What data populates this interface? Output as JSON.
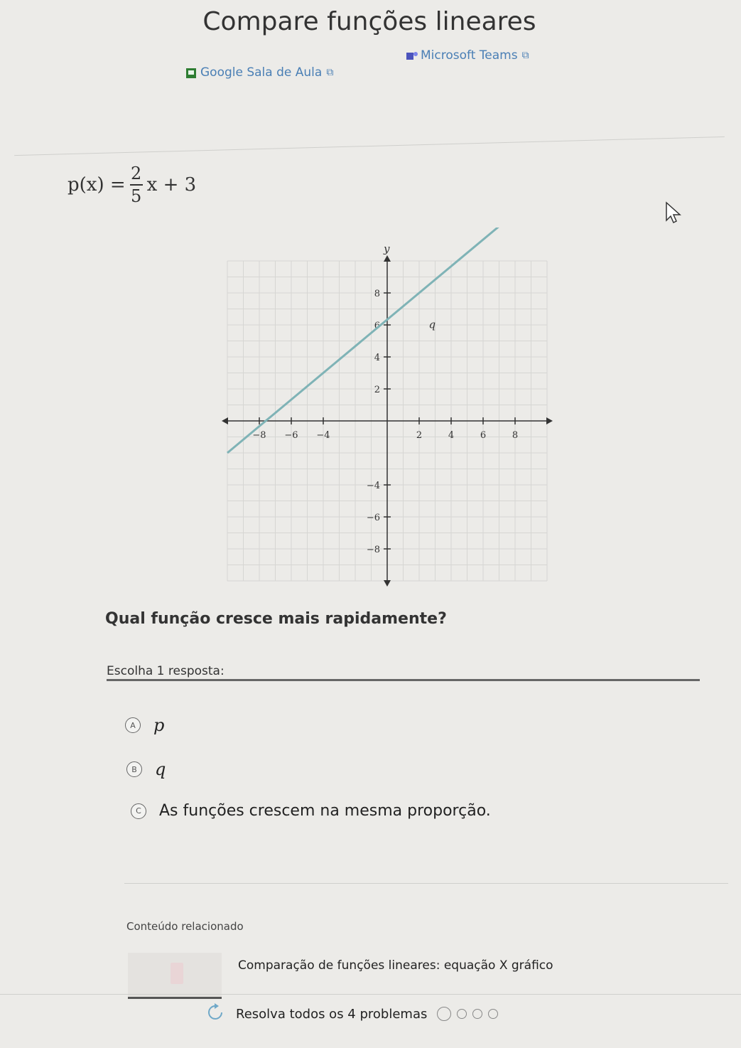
{
  "page_title": "Compare funções lineares",
  "links": [
    {
      "label": "Google Sala de Aula",
      "icon": "google-classroom-icon"
    },
    {
      "label": "Microsoft Teams",
      "icon": "microsoft-teams-icon"
    }
  ],
  "formula": {
    "lhs": "p(x) =",
    "numerator": "2",
    "denominator": "5",
    "rhs": "x + 3"
  },
  "chart_data": {
    "type": "line",
    "title": "",
    "xlabel": "x",
    "ylabel": "y",
    "xlim": [
      -10,
      10
    ],
    "ylim": [
      -10,
      10
    ],
    "x_ticks": [
      -8,
      -6,
      -4,
      2,
      4,
      6,
      8
    ],
    "y_ticks": [
      8,
      6,
      4,
      2,
      -4,
      -6,
      -8
    ],
    "grid": true,
    "series": [
      {
        "name": "q",
        "x": [
          -10,
          8
        ],
        "y": [
          -2,
          13
        ],
        "color": "#7fb3b6"
      }
    ]
  },
  "question": "Qual função cresce mais rapidamente?",
  "choose_label": "Escolha 1 resposta:",
  "options": [
    {
      "letter": "A",
      "label": "p"
    },
    {
      "letter": "B",
      "label": "q"
    },
    {
      "letter": "C",
      "label": "As funções crescem na mesma proporção."
    }
  ],
  "related": {
    "title": "Conteúdo relacionado",
    "link": "Comparação de funções lineares: equação X gráfico"
  },
  "progress": {
    "label": "Resolva todos os 4 problemas",
    "total": 4,
    "completed": 0
  }
}
